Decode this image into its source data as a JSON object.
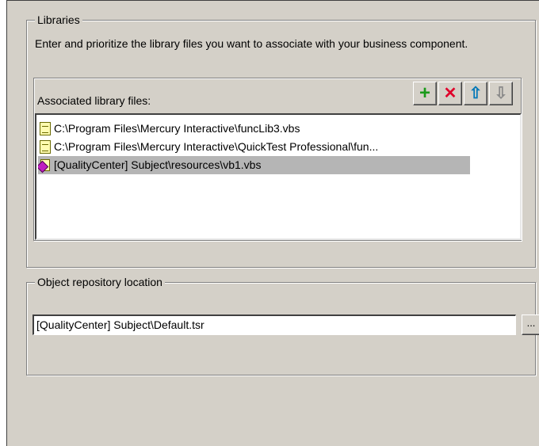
{
  "libraries": {
    "legend": "Libraries",
    "description": "Enter and prioritize the library files you want to associate with your business component.",
    "associated_label": "Associated library files:",
    "toolbar": {
      "add_label": "+",
      "remove_label": "✕",
      "up_label": "⇧",
      "down_label": "⇩",
      "add_color": "#1a9a1a",
      "remove_color": "#e0002a",
      "up_color": "#0077b8",
      "down_color": "#8a8a8a"
    },
    "files": [
      {
        "icon": "file-icon",
        "path": "C:\\Program Files\\Mercury Interactive\\funcLib3.vbs",
        "selected": false
      },
      {
        "icon": "file-icon",
        "path": "C:\\Program Files\\Mercury Interactive\\QuickTest Professional\\fun...",
        "selected": false
      },
      {
        "icon": "qualitycenter-icon",
        "path": "[QualityCenter] Subject\\resources\\vb1.vbs",
        "selected": true
      }
    ]
  },
  "object_repository": {
    "legend": "Object repository location",
    "location_value": "[QualityCenter] Subject\\Default.tsr",
    "browse_label": "..."
  }
}
